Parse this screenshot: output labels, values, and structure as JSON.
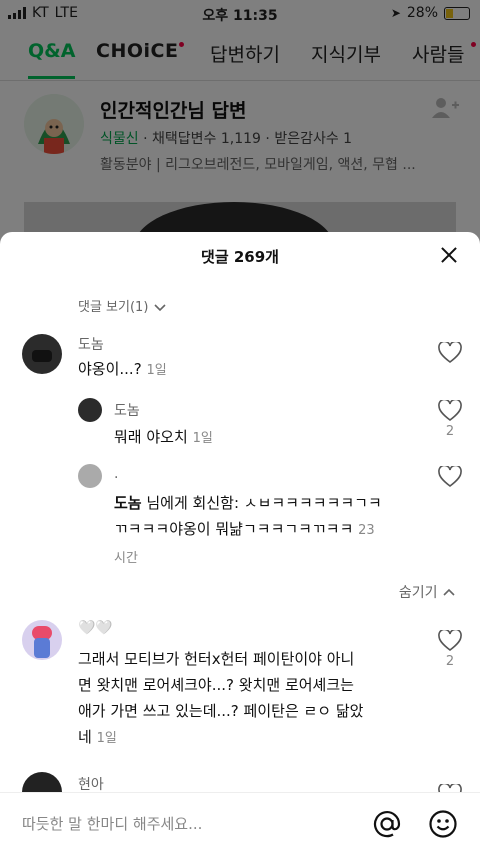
{
  "status": {
    "carrier": "KT",
    "network": "LTE",
    "time": "오후 11:35",
    "battery": "28%"
  },
  "nav": {
    "tabs": [
      "Q&A",
      "CHOiCE",
      "답변하기",
      "지식기부",
      "사람들"
    ],
    "active": "Q&A"
  },
  "profile": {
    "title": "인간적인간님 답변",
    "level": "식물신",
    "adopted_label": "채택답변수",
    "adopted_count": "1,119",
    "thanks_label": "받은감사수",
    "thanks_count": "1",
    "field_label": "활동분야",
    "fields": "리그오브레전드, 모바일게임, 액션, 무협 ..."
  },
  "comments_sheet": {
    "title": "댓글 269개",
    "view_replies": "댓글 보기(1)",
    "hide_label": "숨기기",
    "input_placeholder": "따듯한 말 한마디 해주세요...",
    "comments": [
      {
        "name": "도놈",
        "text": "야옹이...?",
        "time": "1일",
        "likes": ""
      },
      {
        "name": "도놈",
        "text": "뭐래 야오치",
        "time": "1일",
        "likes": "2",
        "reply": true
      },
      {
        "name": ".",
        "mention": "도놈",
        "mention_suffix": " 님에게 회신함:",
        "text1": "ㅅㅂㅋㅋㅋㅋㅋㅋㄱㅋ",
        "text2": "ㄲㅋㅋㅋ야옹이 뭐냚ㄱㅋㅋㄱㅋㄲㅋㅋ",
        "time": "23",
        "time2": "시간",
        "reply": true
      },
      {
        "name": "🤍🤍",
        "text1": "그래서 모티브가 헌터x헌터 페이탄이야 아니",
        "text2": "면 왓치맨 로어셰크야...? 왓치맨 로어셰크는",
        "text3": "애가 가면 쓰고 있는데...? 페이탄은 ㄹㅇ 닮았",
        "text4": "네",
        "time": "1일",
        "likes": "2"
      },
      {
        "name": "현아"
      }
    ]
  },
  "colors": {
    "accent": "#03c75a",
    "overlay": "rgba(0,0,0,0.5)"
  },
  "icons": [
    "back-chevron-icon",
    "add-user-icon",
    "close-icon",
    "chevron-down-icon",
    "heart-icon",
    "chevron-up-icon",
    "at-icon",
    "emoji-icon"
  ]
}
